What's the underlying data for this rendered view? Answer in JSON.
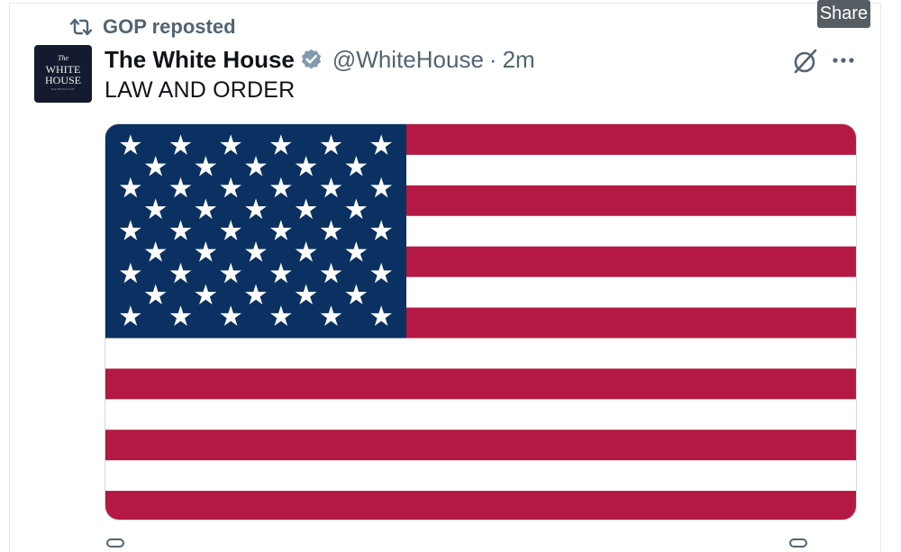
{
  "tooltip": {
    "label": "Share"
  },
  "repost": {
    "label": "GOP reposted",
    "icon": "repost-icon"
  },
  "author": {
    "display_name": "The White House",
    "handle": "@WhiteHouse",
    "separator": "·",
    "time": "2m",
    "verified_icon": "verified-badge-icon",
    "verified_color": "#829aab",
    "avatar": {
      "line1": "The",
      "line2": "WHITE HOUSE",
      "line3": "WASHINGTON",
      "bg_color": "#141b30"
    }
  },
  "tweet": {
    "text": "LAW AND ORDER"
  },
  "media": {
    "image": "american-flag",
    "stripe_red": "#b31942",
    "stripe_white": "#ffffff",
    "canton_blue": "#0a3161"
  },
  "icons": {
    "grok": "grok-icon",
    "more": "more-icon"
  },
  "colors": {
    "secondary_text": "#536471",
    "primary_text": "#0f1419"
  }
}
